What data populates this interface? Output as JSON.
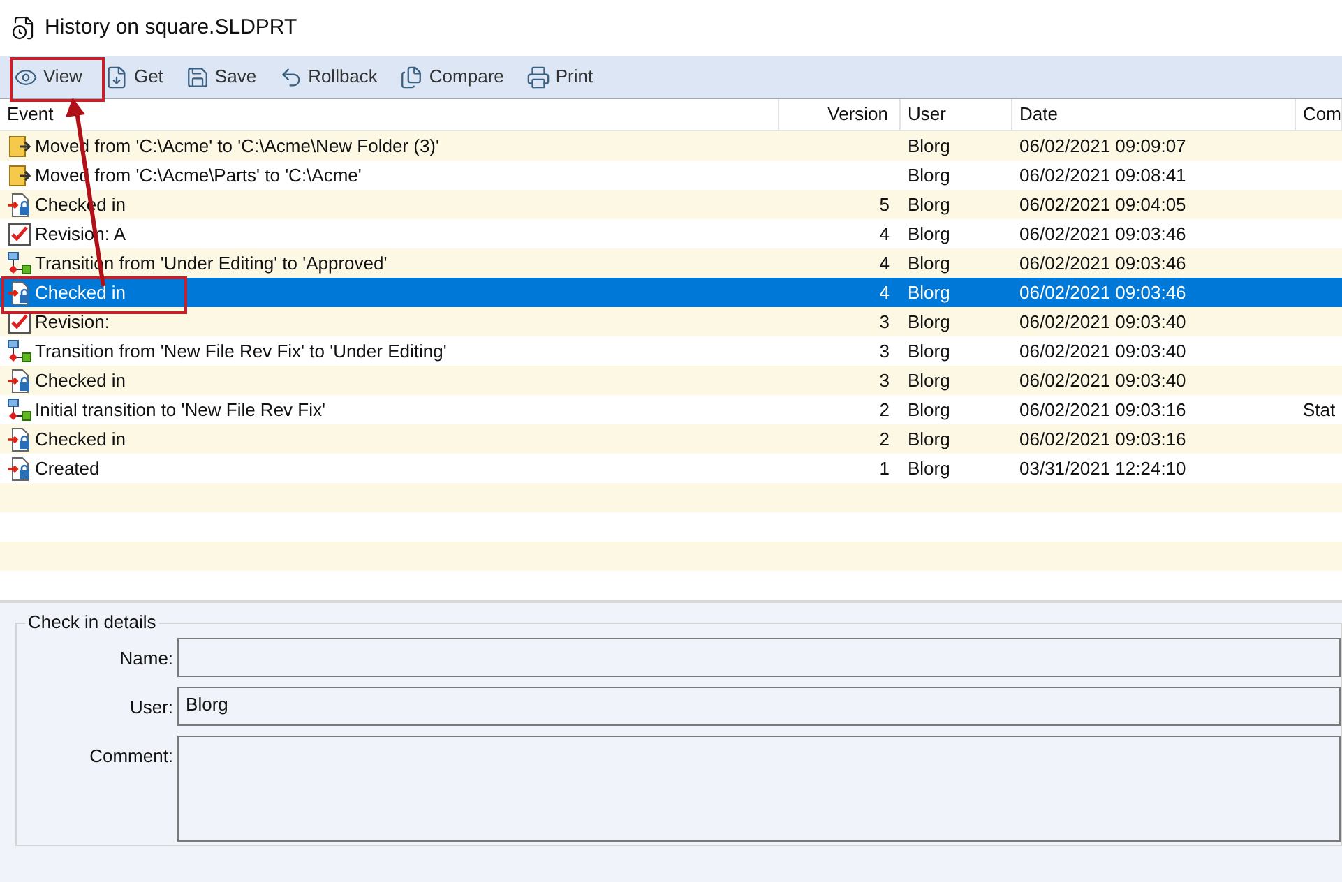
{
  "window": {
    "title": "History on square.SLDPRT"
  },
  "toolbar": [
    {
      "label": "View",
      "kind": "view"
    },
    {
      "label": "Get",
      "kind": "get"
    },
    {
      "label": "Save",
      "kind": "save"
    },
    {
      "label": "Rollback",
      "kind": "rollback"
    },
    {
      "label": "Compare",
      "kind": "compare"
    },
    {
      "label": "Print",
      "kind": "print"
    }
  ],
  "table": {
    "columns": [
      "Event",
      "Version",
      "User",
      "Date",
      "Com"
    ],
    "rows": [
      {
        "kind": "move",
        "event": "Moved from 'C:\\Acme' to 'C:\\Acme\\New Folder (3)'",
        "version": "",
        "user": "Blorg",
        "date": "06/02/2021 09:09:07",
        "comment": "",
        "selected": false
      },
      {
        "kind": "move",
        "event": "Moved from 'C:\\Acme\\Parts' to 'C:\\Acme'",
        "version": "",
        "user": "Blorg",
        "date": "06/02/2021 09:08:41",
        "comment": "",
        "selected": false
      },
      {
        "kind": "checkin",
        "event": "Checked in",
        "version": "5",
        "user": "Blorg",
        "date": "06/02/2021 09:04:05",
        "comment": "",
        "selected": false
      },
      {
        "kind": "revision",
        "event": "Revision: A",
        "version": "4",
        "user": "Blorg",
        "date": "06/02/2021 09:03:46",
        "comment": "",
        "selected": false
      },
      {
        "kind": "transition",
        "event": "Transition from 'Under Editing' to 'Approved'",
        "version": "4",
        "user": "Blorg",
        "date": "06/02/2021 09:03:46",
        "comment": "",
        "selected": false
      },
      {
        "kind": "checkin",
        "event": "Checked in",
        "version": "4",
        "user": "Blorg",
        "date": "06/02/2021 09:03:46",
        "comment": "",
        "selected": true
      },
      {
        "kind": "revision",
        "event": "Revision:",
        "version": "3",
        "user": "Blorg",
        "date": "06/02/2021 09:03:40",
        "comment": "",
        "selected": false
      },
      {
        "kind": "transition",
        "event": "Transition from 'New File Rev Fix' to 'Under Editing'",
        "version": "3",
        "user": "Blorg",
        "date": "06/02/2021 09:03:40",
        "comment": "",
        "selected": false
      },
      {
        "kind": "checkin",
        "event": "Checked in",
        "version": "3",
        "user": "Blorg",
        "date": "06/02/2021 09:03:40",
        "comment": "",
        "selected": false
      },
      {
        "kind": "transition",
        "event": "Initial transition to 'New File Rev Fix'",
        "version": "2",
        "user": "Blorg",
        "date": "06/02/2021 09:03:16",
        "comment": "Stat",
        "selected": false
      },
      {
        "kind": "checkin",
        "event": "Checked in",
        "version": "2",
        "user": "Blorg",
        "date": "06/02/2021 09:03:16",
        "comment": "",
        "selected": false
      },
      {
        "kind": "checkin",
        "event": "Created",
        "version": "1",
        "user": "Blorg",
        "date": "03/31/2021 12:24:10",
        "comment": "",
        "selected": false
      }
    ]
  },
  "details": {
    "title": "Check in details",
    "fields": [
      {
        "label": "Name:",
        "kind": "line"
      },
      {
        "label": "User:",
        "kind": "line",
        "value": "Blorg"
      },
      {
        "label": "Comment:",
        "kind": "multiline"
      }
    ]
  }
}
